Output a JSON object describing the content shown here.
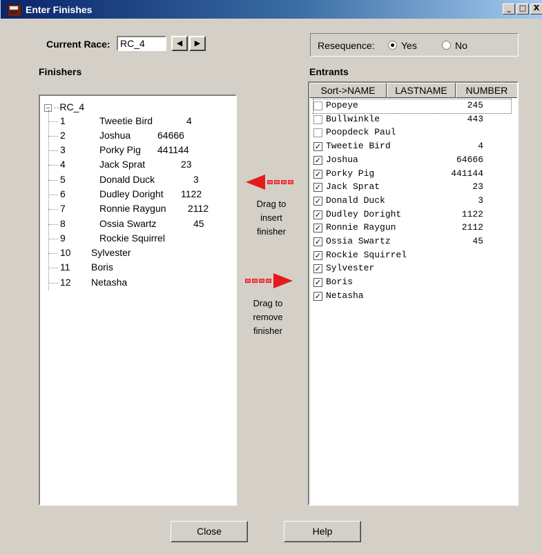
{
  "window": {
    "title": "Enter Finishes",
    "controls": [
      "_",
      "□",
      "X"
    ]
  },
  "race": {
    "label": "Current Race:",
    "value": "RC_4",
    "prev_icon": "◀",
    "next_icon": "▶"
  },
  "resequence": {
    "label": "Resequence:",
    "yes": "Yes",
    "no": "No",
    "selected": "Yes"
  },
  "finishers": {
    "label": "Finishers",
    "root": "RC_4",
    "items": [
      {
        "pos": "1",
        "name": "Tweetie Bird",
        "num": "4"
      },
      {
        "pos": "2",
        "name": "Joshua",
        "num": "64666"
      },
      {
        "pos": "3",
        "name": "Porky Pig",
        "num": "441144"
      },
      {
        "pos": "4",
        "name": "Jack Sprat",
        "num": "23"
      },
      {
        "pos": "5",
        "name": "Donald Duck",
        "num": "3"
      },
      {
        "pos": "6",
        "name": "Dudley Doright",
        "num": "1122"
      },
      {
        "pos": "7",
        "name": "Ronnie Raygun",
        "num": "2112"
      },
      {
        "pos": "8",
        "name": "Ossia Swartz",
        "num": "45"
      },
      {
        "pos": "9",
        "name": "Rockie Squirrel",
        "num": ""
      },
      {
        "pos": "10",
        "name": "Sylvester",
        "num": ""
      },
      {
        "pos": "11",
        "name": "Boris",
        "num": ""
      },
      {
        "pos": "12",
        "name": "Netasha",
        "num": ""
      }
    ]
  },
  "hints": {
    "insert": [
      "Drag to",
      "insert",
      "finisher"
    ],
    "remove": [
      "Drag to",
      "remove",
      "finisher"
    ]
  },
  "entrants": {
    "label": "Entrants",
    "columns": [
      "Sort->NAME",
      "LASTNAME",
      "NUMBER"
    ],
    "items": [
      {
        "checked": false,
        "name": "Popeye",
        "num": "245"
      },
      {
        "checked": false,
        "name": "Bullwinkle",
        "num": "443"
      },
      {
        "checked": false,
        "name": "Poopdeck Paul",
        "num": ""
      },
      {
        "checked": true,
        "name": "Tweetie Bird",
        "num": "4"
      },
      {
        "checked": true,
        "name": "Joshua",
        "num": "64666"
      },
      {
        "checked": true,
        "name": "Porky Pig",
        "num": "441144"
      },
      {
        "checked": true,
        "name": "Jack Sprat",
        "num": "23"
      },
      {
        "checked": true,
        "name": "Donald Duck",
        "num": "3"
      },
      {
        "checked": true,
        "name": "Dudley Doright",
        "num": "1122"
      },
      {
        "checked": true,
        "name": "Ronnie Raygun",
        "num": "2112"
      },
      {
        "checked": true,
        "name": "Ossia Swartz",
        "num": "45"
      },
      {
        "checked": true,
        "name": "Rockie Squirrel",
        "num": ""
      },
      {
        "checked": true,
        "name": "Sylvester",
        "num": ""
      },
      {
        "checked": true,
        "name": "Boris",
        "num": ""
      },
      {
        "checked": true,
        "name": "Netasha",
        "num": ""
      }
    ]
  },
  "buttons": {
    "close": "Close",
    "help": "Help"
  },
  "colors": {
    "window_bg": "#d4d0c8",
    "title_start": "#0a246a",
    "title_end": "#a6caf0",
    "arrow": "#e41b1b"
  }
}
